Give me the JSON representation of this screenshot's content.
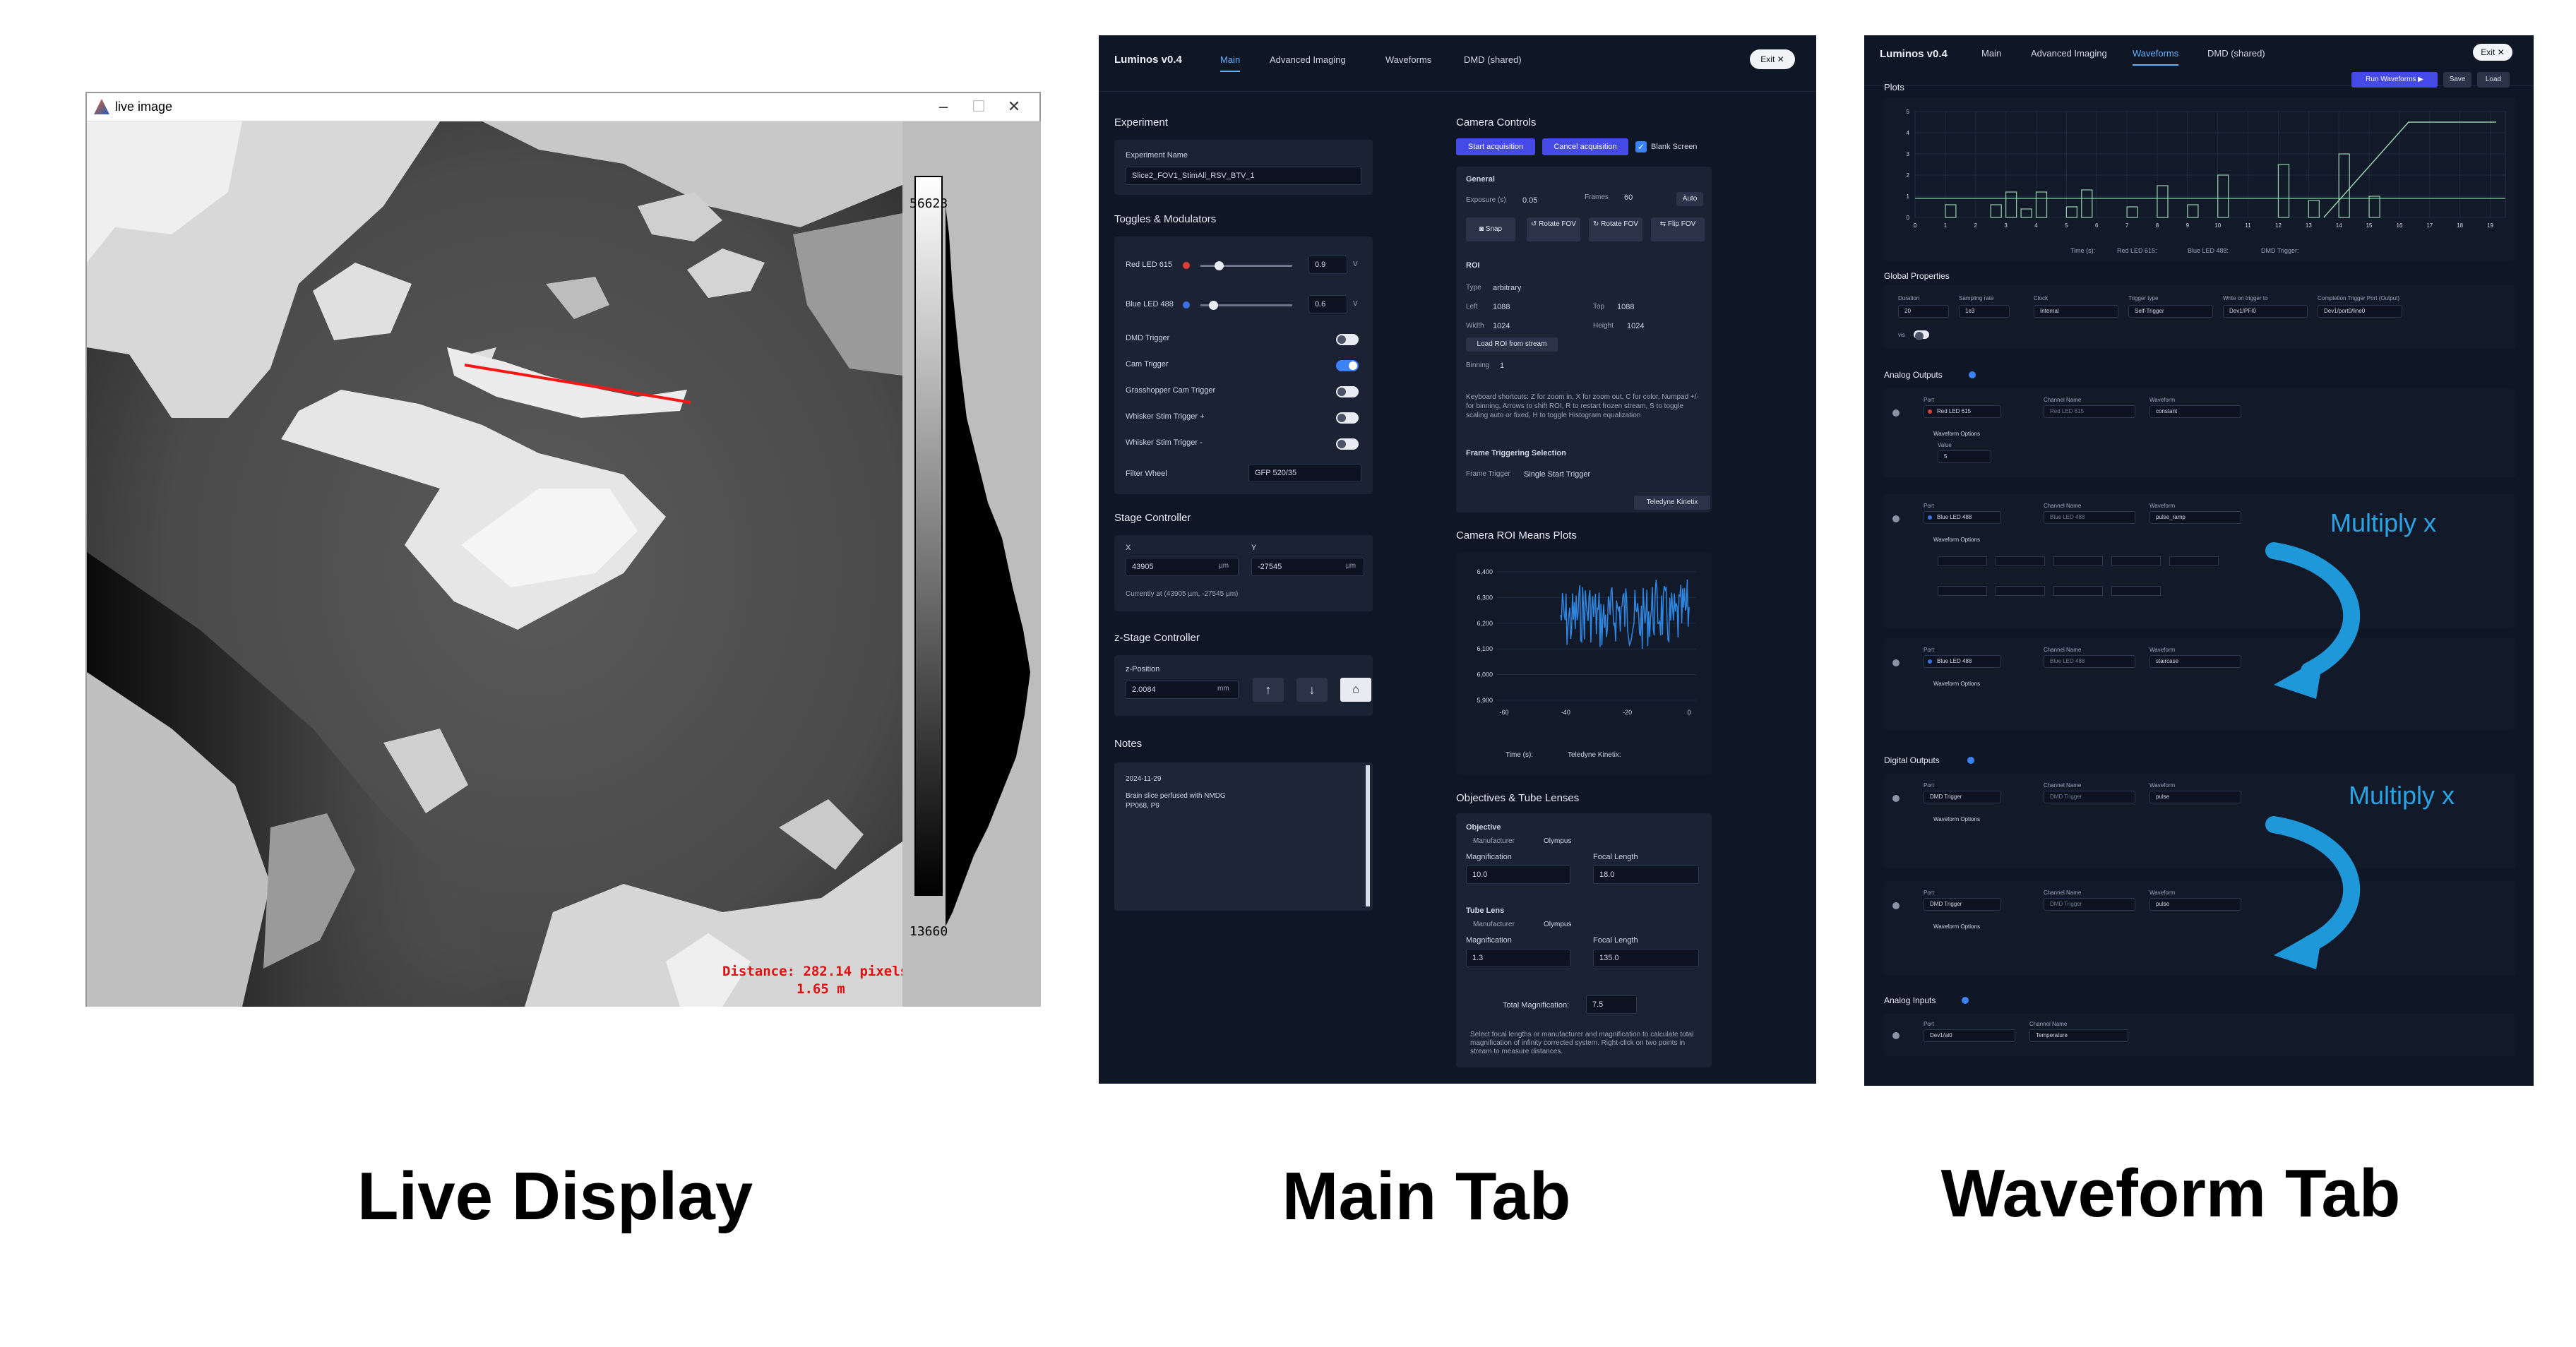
{
  "captions": {
    "live": "Live Display",
    "main": "Main Tab",
    "wave": "Waveform Tab"
  },
  "live": {
    "title": "live image",
    "win_buttons": [
      "–",
      "☐",
      "✕"
    ],
    "colorbar_max": "56623",
    "colorbar_min": "13660",
    "distance_line1": "Distance: 282.14 pixels",
    "distance_line2": "1.65 m"
  },
  "main": {
    "brand": "Luminos v0.4",
    "tabs": [
      "Main",
      "Advanced Imaging",
      "Waveforms",
      "DMD (shared)"
    ],
    "exit": "Exit ✕",
    "experiment": {
      "section": "Experiment",
      "name_label": "Experiment Name",
      "name_value": "Slice2_FOV1_StimAll_RSV_BTV_1"
    },
    "toggles": {
      "section": "Toggles & Modulators",
      "red_label": "Red LED 615",
      "red_value": "0.9",
      "red_unit": "V",
      "red_color": "#e23b3b",
      "blue_label": "Blue LED 488",
      "blue_value": "0.6",
      "blue_unit": "V",
      "blue_color": "#3b6fe2",
      "dmd": "DMD Trigger",
      "cam": "Cam Trigger",
      "grass": "Grasshopper Cam Trigger",
      "wplus": "Whisker Stim Trigger +",
      "wminus": "Whisker Stim Trigger -",
      "filter_label": "Filter Wheel",
      "filter_value": "GFP 520/35"
    },
    "stage": {
      "section": "Stage Controller",
      "x_label": "X",
      "x_value": "43905",
      "y_label": "Y",
      "y_value": "-27545",
      "unit": "µm",
      "current": "Currently at (43905 µm, -27545 µm)"
    },
    "zstage": {
      "section": "z-Stage Controller",
      "z_label": "z-Position",
      "z_value": "2.0084",
      "unit": "mm"
    },
    "notes": {
      "section": "Notes",
      "line1": "2024-11-29",
      "line2": "Brain slice perfused with NMDG",
      "line3": "PP068, P9"
    },
    "camera": {
      "section": "Camera Controls",
      "start": "Start acquisition",
      "cancel": "Cancel acquisition",
      "blank": "Blank Screen",
      "general": "General",
      "exposure_label": "Exposure (s)",
      "exposure": "0.05",
      "frames_label": "Frames",
      "frames": "60",
      "auto": "Auto",
      "snap": "Snap",
      "rotate1": "Rotate FOV",
      "rotate2": "Rotate FOV",
      "flip": "Flip FOV",
      "roi": "ROI",
      "type_label": "Type",
      "type_value": "arbitrary",
      "left_label": "Left",
      "left": "1088",
      "top_label": "Top",
      "top": "1088",
      "width_label": "Width",
      "width": "1024",
      "height_label": "Height",
      "height": "1024",
      "load_roi": "Load ROI from stream",
      "binning_label": "Binning",
      "binning": "1",
      "help": "Keyboard shortcuts: Z for zoom in, X for zoom out, C for color, Numpad +/- for binning, Arrows to shift ROI, R to restart frozen stream, S to toggle scaling auto or fixed, H to toggle Histogram equalization",
      "frame_sel": "Frame Triggering Selection",
      "trigger_label": "Frame Trigger",
      "trigger_value": "Single Start Trigger",
      "camera_name": "Teledyne Kinetix"
    },
    "roi_plot": {
      "section": "Camera ROI Means Plots",
      "yticks": [
        "6,400",
        "6,300",
        "6,200",
        "6,100",
        "6,000",
        "5,900"
      ],
      "xticks": [
        "-60",
        "-40",
        "-20",
        "0"
      ],
      "legend_time": "Time (s):",
      "legend_cam": "Teledyne Kinetix:",
      "line_color": "#2f86e0"
    },
    "objectives": {
      "section": "Objectives & Tube Lenses",
      "obj": "Objective",
      "manufacturer_label": "Manufacturer",
      "obj_manu": "Olympus",
      "mag_label": "Magnification",
      "obj_mag": "10.0",
      "fl_label": "Focal Length",
      "obj_fl": "18.0",
      "fl_unit": "mm",
      "tube": "Tube Lens",
      "tube_manu": "Olympus",
      "tube_mag": "1.3",
      "tube_fl": "135.0",
      "total_label": "Total Magnification:",
      "total": "7.5",
      "help": "Select focal lengths or manufacturer and magnification to calculate total magnification of infinity corrected system. Right-click on two points in stream to measure distances."
    }
  },
  "wave": {
    "brand": "Luminos v0.4",
    "tabs": [
      "Main",
      "Advanced Imaging",
      "Waveforms",
      "DMD (shared)"
    ],
    "exit": "Exit ✕",
    "plots": "Plots",
    "run": "Run Waveforms ▶",
    "save": "Save",
    "load": "Load",
    "chart_data": {
      "type": "line",
      "x": [
        0,
        1,
        2,
        3,
        4,
        5,
        6,
        7,
        8,
        9,
        10,
        11,
        12,
        13,
        14,
        15,
        16,
        17,
        18,
        19
      ],
      "xticks": [
        "0",
        "1",
        "2",
        "3",
        "4",
        "5",
        "6",
        "7",
        "8",
        "9",
        "10",
        "11",
        "12",
        "13",
        "14",
        "15",
        "16",
        "17",
        "18",
        "19"
      ],
      "yticks": [
        "0",
        "1",
        "2",
        "3",
        "4",
        "5"
      ],
      "ylim": [
        0,
        5
      ],
      "xlim": [
        0,
        19.5
      ],
      "series": [
        {
          "name": "Red LED 615",
          "values": [
            [
              0,
              0.9
            ],
            [
              19.5,
              0.9
            ]
          ]
        },
        {
          "name": "Blue LED 488",
          "pulses": [
            [
              1,
              0.6
            ],
            [
              2.5,
              0.6
            ],
            [
              3,
              1.2
            ],
            [
              3.5,
              0.4
            ],
            [
              4,
              1.2
            ],
            [
              5,
              0.5
            ],
            [
              5.5,
              1.3
            ],
            [
              7,
              0.5
            ],
            [
              8,
              1.5
            ],
            [
              9,
              0.6
            ],
            [
              10,
              2.0
            ],
            [
              12,
              2.5
            ],
            [
              13,
              0.8
            ],
            [
              14,
              3.0
            ],
            [
              15,
              1.0
            ]
          ]
        },
        {
          "name": "DMD Trigger",
          "ramp": [
            [
              13.5,
              0
            ],
            [
              16.3,
              4.5
            ],
            [
              19.2,
              4.5
            ]
          ]
        }
      ],
      "legend": [
        "Time (s):",
        "Red LED 615:",
        "Blue LED 488:",
        "DMD Trigger:"
      ]
    },
    "global": {
      "section": "Global Properties",
      "labels": [
        "Duration",
        "Sampling rate",
        "Clock",
        "Trigger type",
        "Write on trigger to",
        "Completion Trigger Port (Output)"
      ],
      "values": [
        "20",
        "1e3",
        "Internal",
        "Self-Trigger",
        "Dev1/PFI0",
        "Dev1/port0/line0"
      ],
      "vis": "vis"
    },
    "analog_out": "Analog Outputs",
    "port_label": "Port",
    "chan_label": "Channel Name",
    "wave_label": "Waveform",
    "opts_label": "Waveform Options",
    "ao1": {
      "port": "Red LED 615",
      "chan": "Red LED 615",
      "wave": "constant",
      "value_label": "Value",
      "value": "5"
    },
    "ao2": {
      "port": "Blue LED 488",
      "chan": "Blue LED 488",
      "wave": "pulse_ramp"
    },
    "ao3": {
      "port": "Blue LED 488",
      "chan": "Blue LED 488",
      "wave": "staircase"
    },
    "digital_out": "Digital Outputs",
    "do1": {
      "port": "DMD Trigger",
      "chan": "DMD Trigger",
      "wave": "pulse"
    },
    "do2": {
      "port": "DMD Trigger",
      "chan": "DMD Trigger",
      "wave": "pulse"
    },
    "analog_in": "Analog Inputs",
    "ai1": {
      "port": "Dev1/ai0",
      "chan": "Temperature"
    },
    "multiply": "Multiply x"
  }
}
